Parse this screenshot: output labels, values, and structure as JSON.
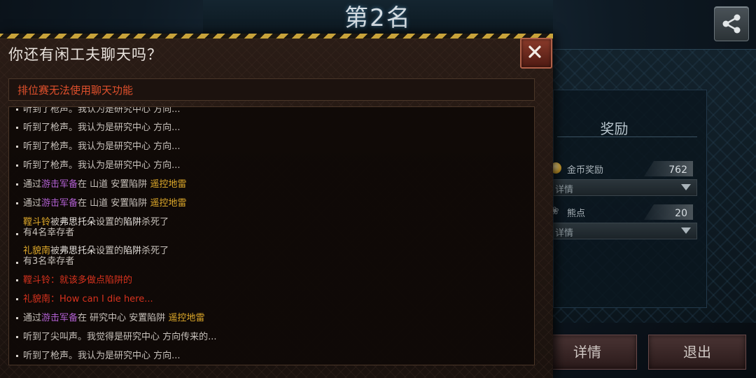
{
  "header": {
    "rank_title": "第2名",
    "share_icon": "share-icon"
  },
  "reward_panel": {
    "title": "奖励",
    "rows": [
      {
        "icon": "coin-icon",
        "name": "金币奖励",
        "value": "762",
        "detail": "详情"
      },
      {
        "icon": "bear-icon",
        "name": "熊点",
        "value": "20",
        "detail": "详情"
      }
    ]
  },
  "bottom_buttons": {
    "detail": "详情",
    "exit": "退出"
  },
  "chat": {
    "title": "你还有闲工夫聊天吗？",
    "close_icon": "close-icon",
    "notice": "排位赛无法使用聊天功能",
    "messages": [
      {
        "parts": [
          {
            "t": "听到了枪声。我认为是研究中心 方向...",
            "c": "default"
          }
        ]
      },
      {
        "parts": [
          {
            "t": "听到了枪声。我认为是研究中心 方向...",
            "c": "default"
          }
        ]
      },
      {
        "parts": [
          {
            "t": "听到了枪声。我认为是研究中心 方向...",
            "c": "default"
          }
        ]
      },
      {
        "parts": [
          {
            "t": "听到了枪声。我认为是研究中心 方向...",
            "c": "default"
          }
        ]
      },
      {
        "parts": [
          {
            "t": "通过",
            "c": "default"
          },
          {
            "t": "游击军备",
            "c": "purple"
          },
          {
            "t": "在 山道 安置陷阱 ",
            "c": "default"
          },
          {
            "t": "遥控地雷",
            "c": "gold"
          }
        ]
      },
      {
        "parts": [
          {
            "t": "通过",
            "c": "default"
          },
          {
            "t": "游击军备",
            "c": "purple"
          },
          {
            "t": "在 山道 安置陷阱 ",
            "c": "default"
          },
          {
            "t": "遥控地雷",
            "c": "gold"
          }
        ]
      },
      {
        "parts": [
          {
            "t": "鞺斗铃",
            "c": "gold"
          },
          {
            "t": "被",
            "c": "default"
          },
          {
            "t": "弗思托朵",
            "c": "white"
          },
          {
            "t": "设置的",
            "c": "default"
          },
          {
            "t": "陷阱",
            "c": "white"
          },
          {
            "t": "杀死了",
            "c": "default"
          }
        ],
        "sub": "有4名幸存者"
      },
      {
        "parts": [
          {
            "t": "礼貌南",
            "c": "gold"
          },
          {
            "t": "被",
            "c": "default"
          },
          {
            "t": "弗思托朵",
            "c": "white"
          },
          {
            "t": "设置的",
            "c": "default"
          },
          {
            "t": "陷阱",
            "c": "white"
          },
          {
            "t": "杀死了",
            "c": "default"
          }
        ],
        "sub": "有3名幸存者"
      },
      {
        "parts": [
          {
            "t": "鞺斗铃：就该多做点陷阱的",
            "c": "red"
          }
        ]
      },
      {
        "parts": [
          {
            "t": "礼貌南：How can I die here...",
            "c": "red"
          }
        ]
      },
      {
        "parts": [
          {
            "t": "通过",
            "c": "default"
          },
          {
            "t": "游击军备",
            "c": "purple"
          },
          {
            "t": "在 研究中心 安置陷阱 ",
            "c": "default"
          },
          {
            "t": "遥控地雷",
            "c": "gold"
          }
        ]
      },
      {
        "parts": [
          {
            "t": "听到了尖叫声。我觉得是研究中心 方向传来的...",
            "c": "default"
          }
        ]
      },
      {
        "parts": [
          {
            "t": "听到了枪声。我认为是研究中心 方向...",
            "c": "default"
          }
        ]
      }
    ]
  },
  "colors": {
    "purple": "#b05fd0",
    "gold": "#e0aa2a",
    "red": "#d8321e",
    "notice": "#e0502c",
    "hazard": "#c8a33a"
  }
}
